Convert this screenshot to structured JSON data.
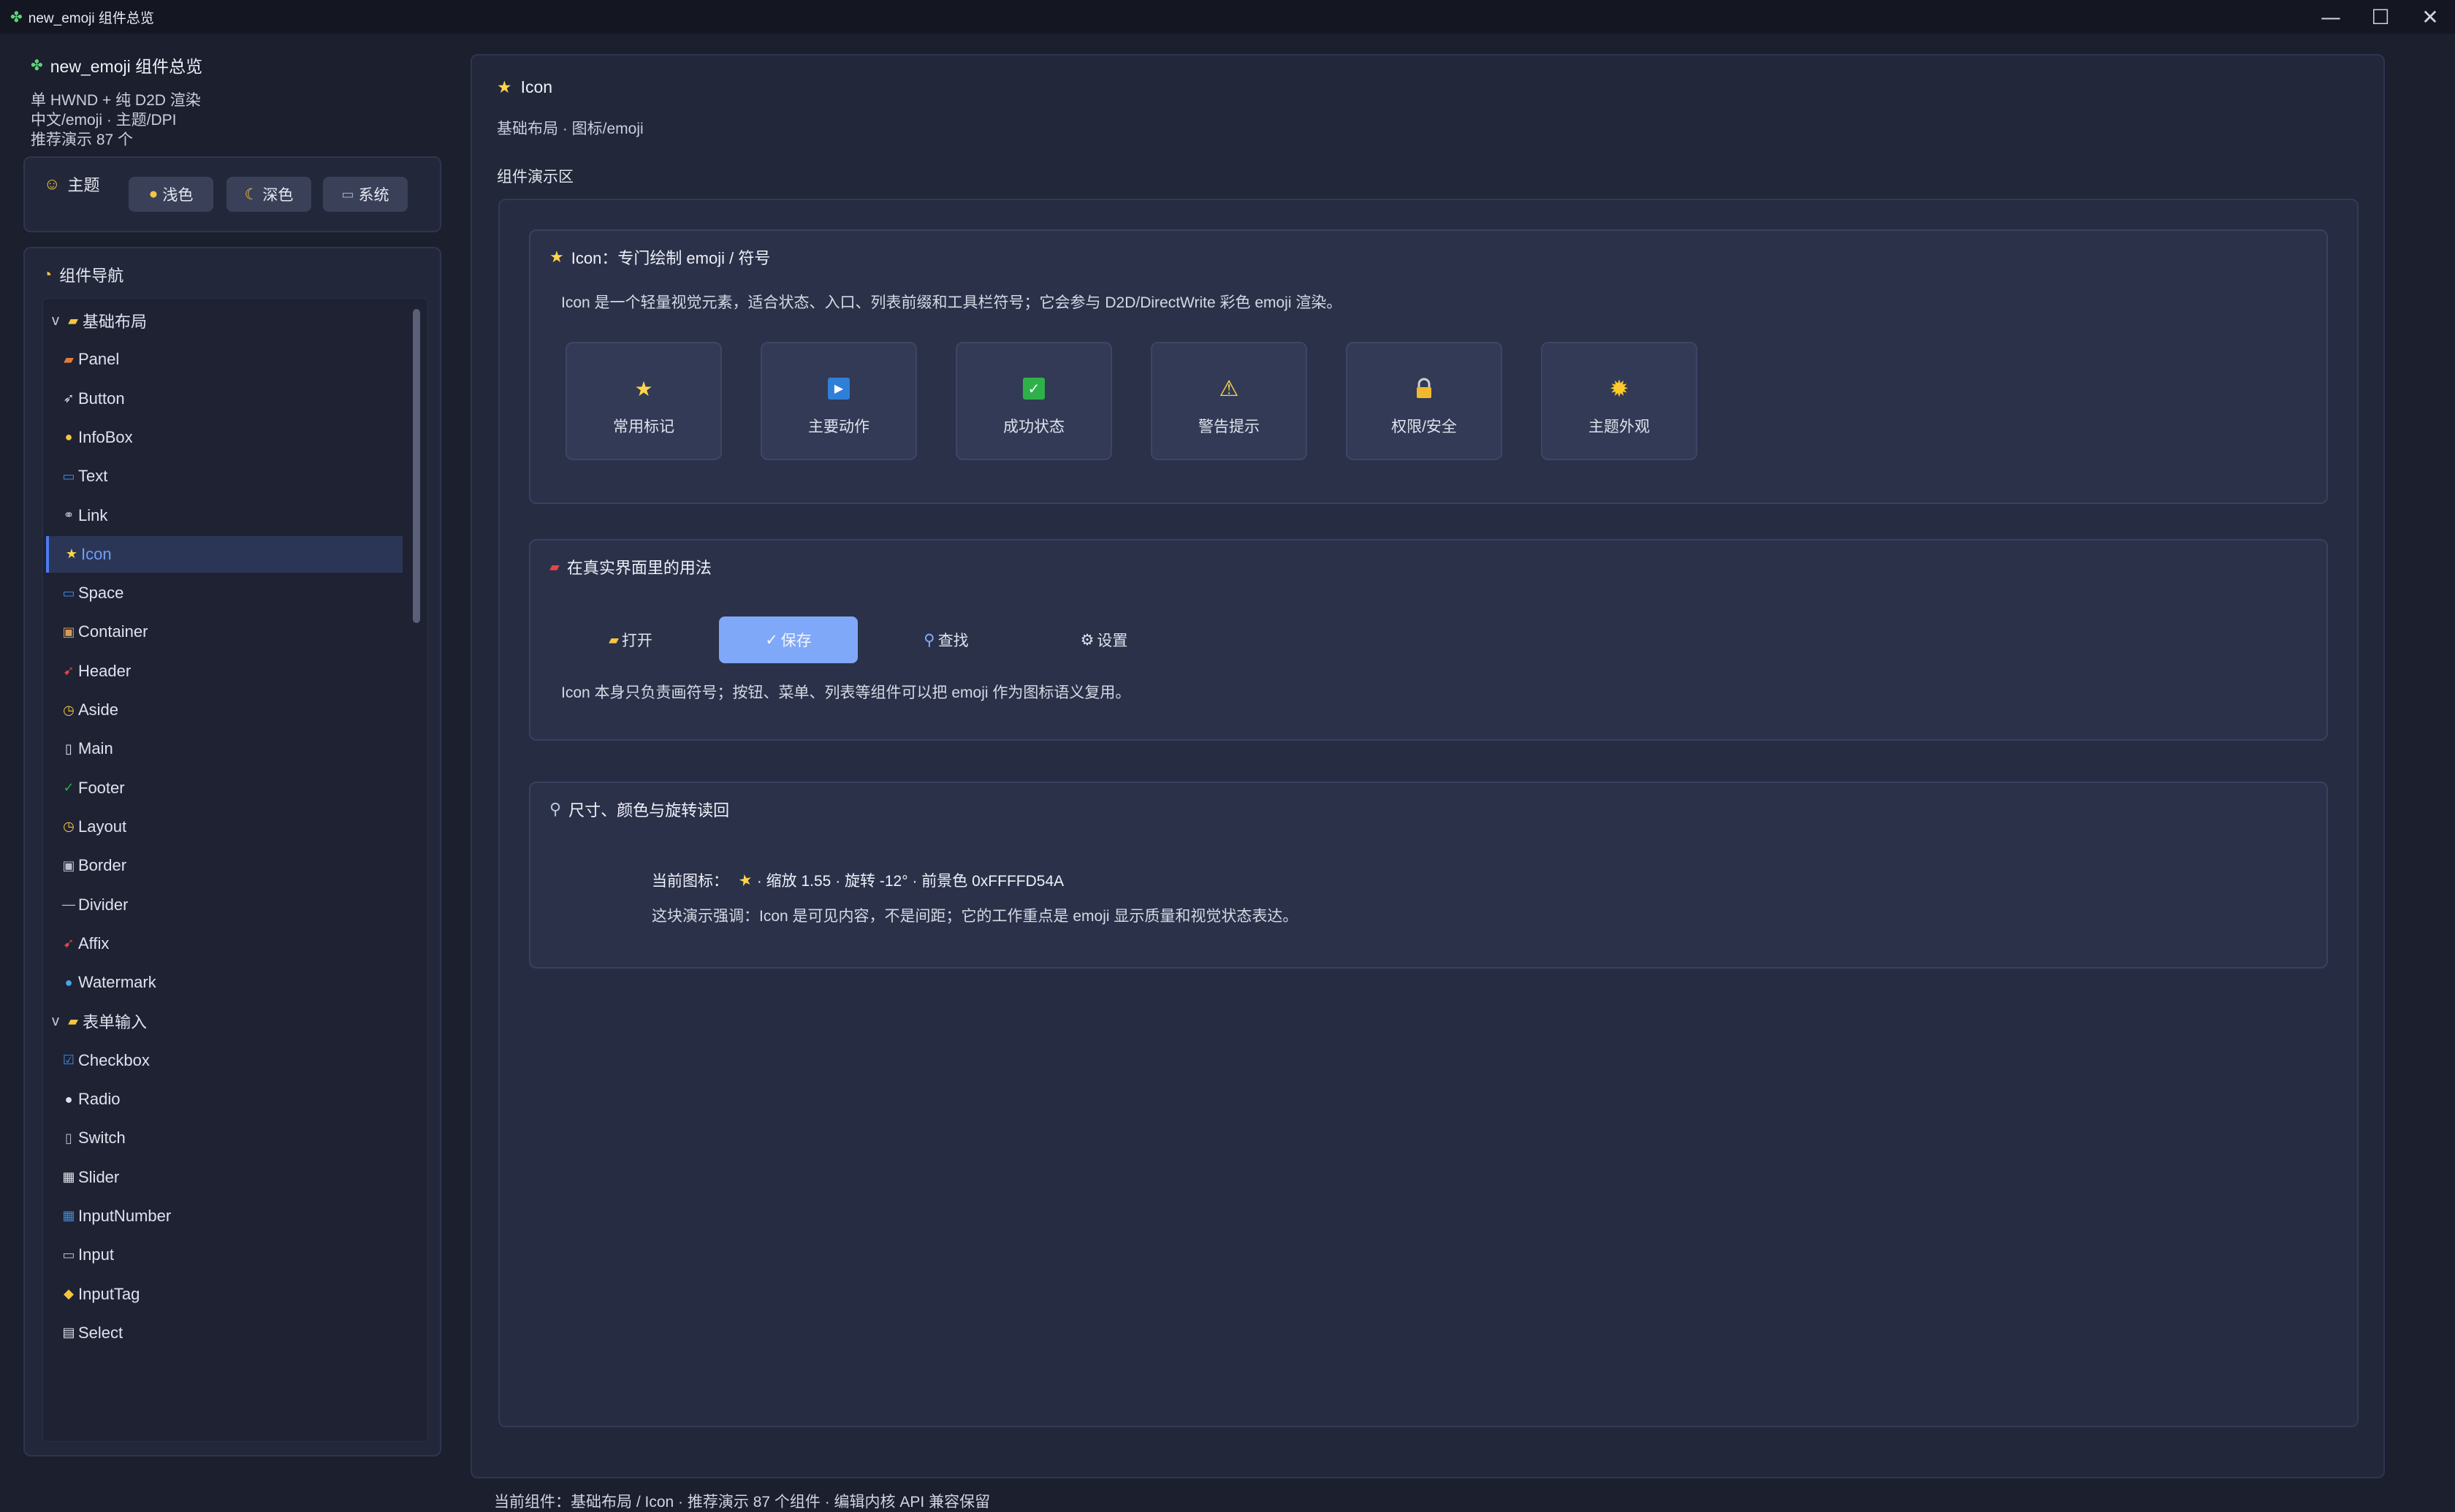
{
  "window": {
    "title": "new_emoji 组件总览",
    "icon": "puzzle-icon",
    "controls": [
      "minimize",
      "maximize",
      "close"
    ]
  },
  "sidebar": {
    "app_name": "new_emoji 组件总览",
    "meta": [
      "单 HWND + 纯 D2D 渲染",
      "中文/emoji · 主题/DPI",
      "推荐演示 87 个"
    ],
    "theme": {
      "label": "主题",
      "buttons": [
        {
          "label": "浅色",
          "icon": "sun-icon"
        },
        {
          "label": "深色",
          "icon": "moon-icon"
        },
        {
          "label": "系统",
          "icon": "laptop-icon"
        }
      ]
    },
    "nav": {
      "label": "组件导航",
      "items": [
        {
          "label": "基础布局",
          "group": true,
          "chev": "v",
          "icon": "folder-icon"
        },
        {
          "label": "Panel",
          "icon": "panel-icon"
        },
        {
          "label": "Button",
          "icon": "rocket-icon"
        },
        {
          "label": "InfoBox",
          "icon": "bulb-icon"
        },
        {
          "label": "Text",
          "icon": "text-icon"
        },
        {
          "label": "Link",
          "icon": "link-icon"
        },
        {
          "label": "Icon",
          "icon": "star-icon",
          "active": true
        },
        {
          "label": "Space",
          "icon": "space-icon"
        },
        {
          "label": "Container",
          "icon": "box-icon"
        },
        {
          "label": "Header",
          "icon": "pin-icon"
        },
        {
          "label": "Aside",
          "icon": "clock-icon"
        },
        {
          "label": "Main",
          "icon": "doc-icon"
        },
        {
          "label": "Footer",
          "icon": "check-icon"
        },
        {
          "label": "Layout",
          "icon": "clock-icon"
        },
        {
          "label": "Border",
          "icon": "border-icon"
        },
        {
          "label": "Divider",
          "icon": "divider-icon"
        },
        {
          "label": "Affix",
          "icon": "pin-icon"
        },
        {
          "label": "Watermark",
          "icon": "drop-icon"
        },
        {
          "label": "表单输入",
          "group": true,
          "chev": "v",
          "icon": "folder-icon"
        },
        {
          "label": "Checkbox",
          "icon": "checkbox-icon"
        },
        {
          "label": "Radio",
          "icon": "radio-icon"
        },
        {
          "label": "Switch",
          "icon": "switch-icon"
        },
        {
          "label": "Slider",
          "icon": "slider-icon"
        },
        {
          "label": "InputNumber",
          "icon": "number-icon"
        },
        {
          "label": "Input",
          "icon": "keyboard-icon"
        },
        {
          "label": "InputTag",
          "icon": "tag-icon"
        },
        {
          "label": "Select",
          "icon": "clipboard-icon"
        }
      ]
    }
  },
  "main": {
    "title": "Icon",
    "title_icon": "star-icon",
    "breadcrumb": "基础布局 · 图标/emoji",
    "demo_label": "组件演示区",
    "card1": {
      "title": "Icon：专门绘制 emoji / 符号",
      "desc": "Icon 是一个轻量视觉元素，适合状态、入口、列表前缀和工具栏符号；它会参与 D2D/DirectWrite 彩色 emoji 渲染。",
      "tiles": [
        {
          "label": "常用标记",
          "icon": "star-icon"
        },
        {
          "label": "主要动作",
          "icon": "play-icon"
        },
        {
          "label": "成功状态",
          "icon": "check-icon"
        },
        {
          "label": "警告提示",
          "icon": "warning-icon"
        },
        {
          "label": "权限/安全",
          "icon": "lock-icon"
        },
        {
          "label": "主题外观",
          "icon": "sun-icon"
        }
      ]
    },
    "card2": {
      "title": "在真实界面里的用法",
      "buttons": [
        {
          "label": "打开",
          "icon": "folder-icon"
        },
        {
          "label": "保存",
          "icon": "check-mark-icon",
          "primary": true
        },
        {
          "label": "查找",
          "icon": "search-icon"
        },
        {
          "label": "设置",
          "icon": "gear-icon"
        }
      ],
      "desc": "Icon 本身只负责画符号；按钮、菜单、列表等组件可以把 emoji 作为图标语义复用。"
    },
    "card3": {
      "title": "尺寸、颜色与旋转读回",
      "current_label": "当前图标：",
      "current_info": " · 缩放 1.55 · 旋转 -12° · 前景色 0xFFFFD54A",
      "note": "这块演示强调：Icon 是可见内容，不是间距；它的工作重点是 emoji 显示质量和视觉状态表达。"
    }
  },
  "status_bar": "当前组件：基础布局 / Icon · 推荐演示 87 个组件 · 编辑内核 API 兼容保留",
  "colors": {
    "accent": "#4b7cf0",
    "primary_button": "#7fa8f8",
    "star": "#ffd54a"
  }
}
